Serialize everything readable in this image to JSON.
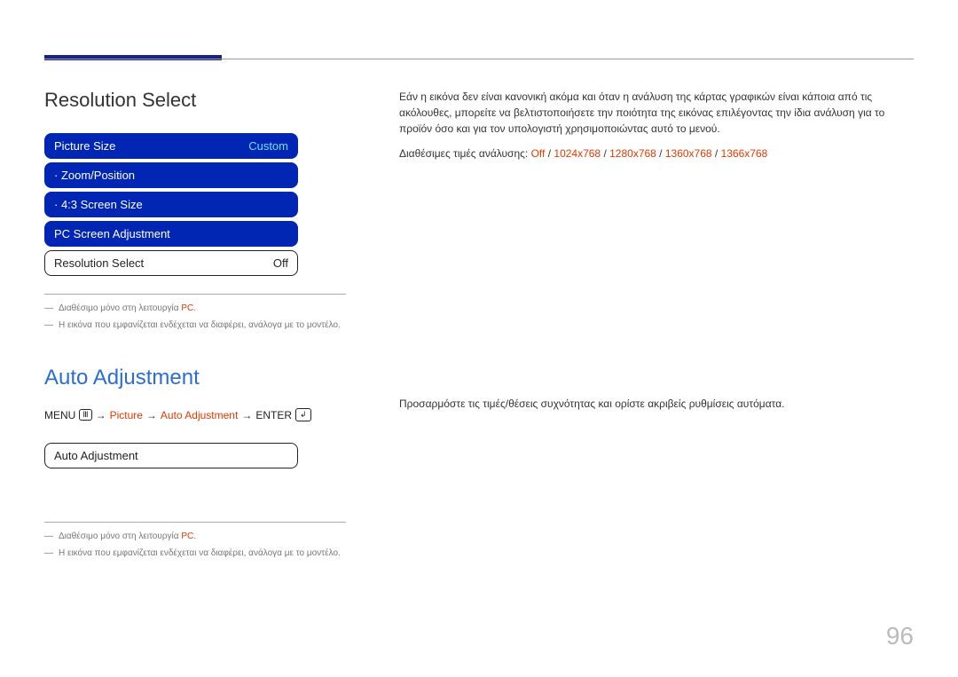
{
  "page_number": "96",
  "section1": {
    "title": "Resolution Select",
    "menu": {
      "picture_size_label": "Picture Size",
      "picture_size_value": "Custom",
      "zoom_position": "· Zoom/Position",
      "screen_43": "· 4:3 Screen Size",
      "pc_screen_adj": "PC Screen Adjustment",
      "resolution_select_label": "Resolution Select",
      "resolution_select_value": "Off"
    },
    "footnotes": {
      "f1_prefix": "Διαθέσιμο μόνο στη λειτουργία ",
      "f1_red": "PC",
      "f1_suffix": ".",
      "f2": "Η εικόνα που εμφανίζεται ενδέχεται να διαφέρει, ανάλογα με το μοντέλο."
    },
    "body_p1": "Εάν η εικόνα δεν είναι κανονική ακόμα και όταν η ανάλυση της κάρτας γραφικών είναι κάποια από τις ακόλουθες, μπορείτε να βελτιστοποιήσετε την ποιότητα της εικόνας επιλέγοντας την ίδια ανάλυση για το προϊόν όσο και για τον υπολογιστή χρησιμοποιώντας αυτό το μενού.",
    "res_label": "Διαθέσιμες τιμές ανάλυσης: ",
    "res_values": [
      "Off",
      "1024x768",
      "1280x768",
      "1360x768",
      "1366x768"
    ],
    "sep": " / "
  },
  "section2": {
    "title": "Auto Adjustment",
    "nav": {
      "menu": "MENU",
      "arrow": "→",
      "picture": "Picture",
      "auto_adj": "Auto Adjustment",
      "enter": "ENTER"
    },
    "menu_row": "Auto Adjustment",
    "footnotes": {
      "f1_prefix": "Διαθέσιμο μόνο στη λειτουργία ",
      "f1_red": "PC",
      "f1_suffix": ".",
      "f2": "Η εικόνα που εμφανίζεται ενδέχεται να διαφέρει, ανάλογα με το μοντέλο."
    },
    "body_p1": "Προσαρμόστε τις τιμές/θέσεις συχνότητας και ορίστε ακριβείς ρυθμίσεις αυτόματα."
  }
}
